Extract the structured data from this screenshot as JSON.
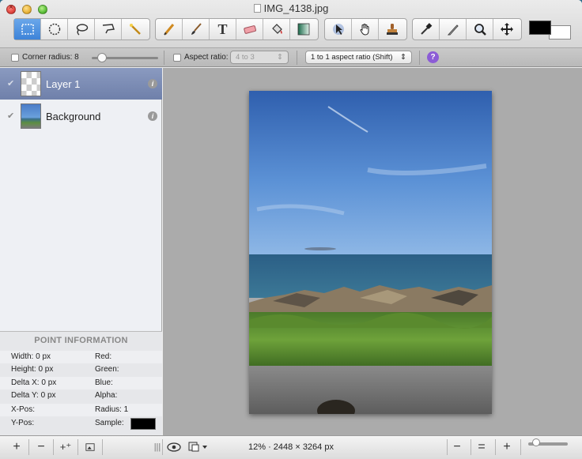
{
  "window": {
    "title": "IMG_4138.jpg"
  },
  "toolbar": {
    "groups": [
      [
        "rect-select-icon",
        "ellipse-select-icon",
        "lasso-icon",
        "polygon-lasso-icon",
        "magic-wand-icon"
      ],
      [
        "pencil-icon",
        "brush-icon",
        "text-icon",
        "eraser-icon",
        "paint-bucket-icon",
        "gradient-icon"
      ],
      [
        "pointer-icon",
        "hand-icon",
        "stamp-icon"
      ],
      [
        "eyedropper-icon",
        "smudge-icon",
        "zoom-icon",
        "move-icon"
      ]
    ],
    "text_tool_glyph": "T",
    "foreground_color": "#000000",
    "background_color": "#ffffff"
  },
  "options": {
    "corner_radius_label": "Corner radius: 8",
    "corner_radius_value": 8,
    "corner_radius_max": 100,
    "aspect_ratio_label": "Aspect ratio:",
    "aspect_ratio_value": "4 to 3",
    "aspect_mode_value": "1 to 1 aspect ratio (Shift)",
    "help_glyph": "?"
  },
  "layers": [
    {
      "name": "Layer 1",
      "selected": true,
      "visible": true
    },
    {
      "name": "Background",
      "selected": false,
      "visible": true
    }
  ],
  "point_info": {
    "title": "POINT INFORMATION",
    "width": "Width:   0 px",
    "height": "Height:  0 px",
    "delta_x": "Delta X: 0 px",
    "delta_y": "Delta Y: 0 px",
    "x_pos": "X-Pos:",
    "y_pos": "Y-Pos:",
    "red": "Red:",
    "green": "Green:",
    "blue": "Blue:",
    "alpha": "Alpha:",
    "radius": "Radius:    1",
    "sample": "Sample:",
    "sample_color": "#000000"
  },
  "statusbar": {
    "info": "12% · 2448 × 3264 px",
    "add": "+",
    "remove": "−",
    "minus": "−",
    "equal": "=",
    "plus": "+",
    "zoom_fraction": 0.12
  }
}
